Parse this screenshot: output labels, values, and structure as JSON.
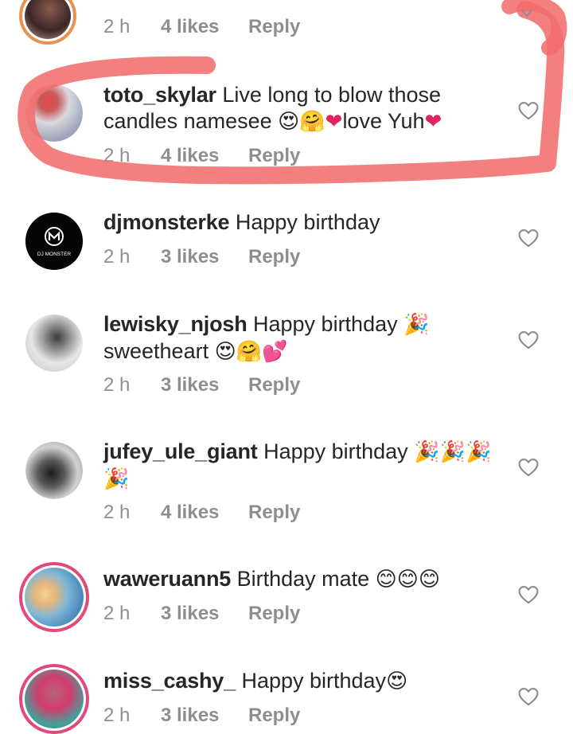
{
  "comments": [
    {
      "username": "",
      "text": "",
      "time": "2 h",
      "likes": "4 likes",
      "reply": "Reply",
      "liked": false
    },
    {
      "username": "toto_skylar",
      "text_line1": "Live long to blow those",
      "text_line2": "candles namesee",
      "text_line2_end": "love Yuh",
      "time": "2 h",
      "likes": "4 likes",
      "reply": "Reply"
    },
    {
      "username": "djmonsterke",
      "text": "Happy birthday",
      "time": "2 h",
      "likes": "3 likes",
      "reply": "Reply",
      "avatar_text": "DJ MONSTER"
    },
    {
      "username": "lewisky_njosh",
      "text_line1": "Happy birthday",
      "text_line2": "sweetheart",
      "time": "2 h",
      "likes": "3 likes",
      "reply": "Reply"
    },
    {
      "username": "jufey_ule_giant",
      "text_line1": "Happy birthday",
      "time": "2 h",
      "likes": "4 likes",
      "reply": "Reply"
    },
    {
      "username": "waweruann5",
      "text": "Birthday mate",
      "time": "2 h",
      "likes": "3 likes",
      "reply": "Reply"
    },
    {
      "username": "miss_cashy_",
      "text": "Happy birthday",
      "time": "2 h",
      "likes": "3 likes",
      "reply": "Reply"
    }
  ],
  "emoji": {
    "heart_eyes": "😍",
    "hug": "🤗",
    "red_heart": "❤",
    "party": "🎉",
    "two_hearts": "💕",
    "blush": "😊"
  },
  "colors": {
    "annotation": "#f26d6d",
    "story_ring": "#e9924e",
    "meta_text": "#8e8e8e",
    "text": "#262626"
  }
}
